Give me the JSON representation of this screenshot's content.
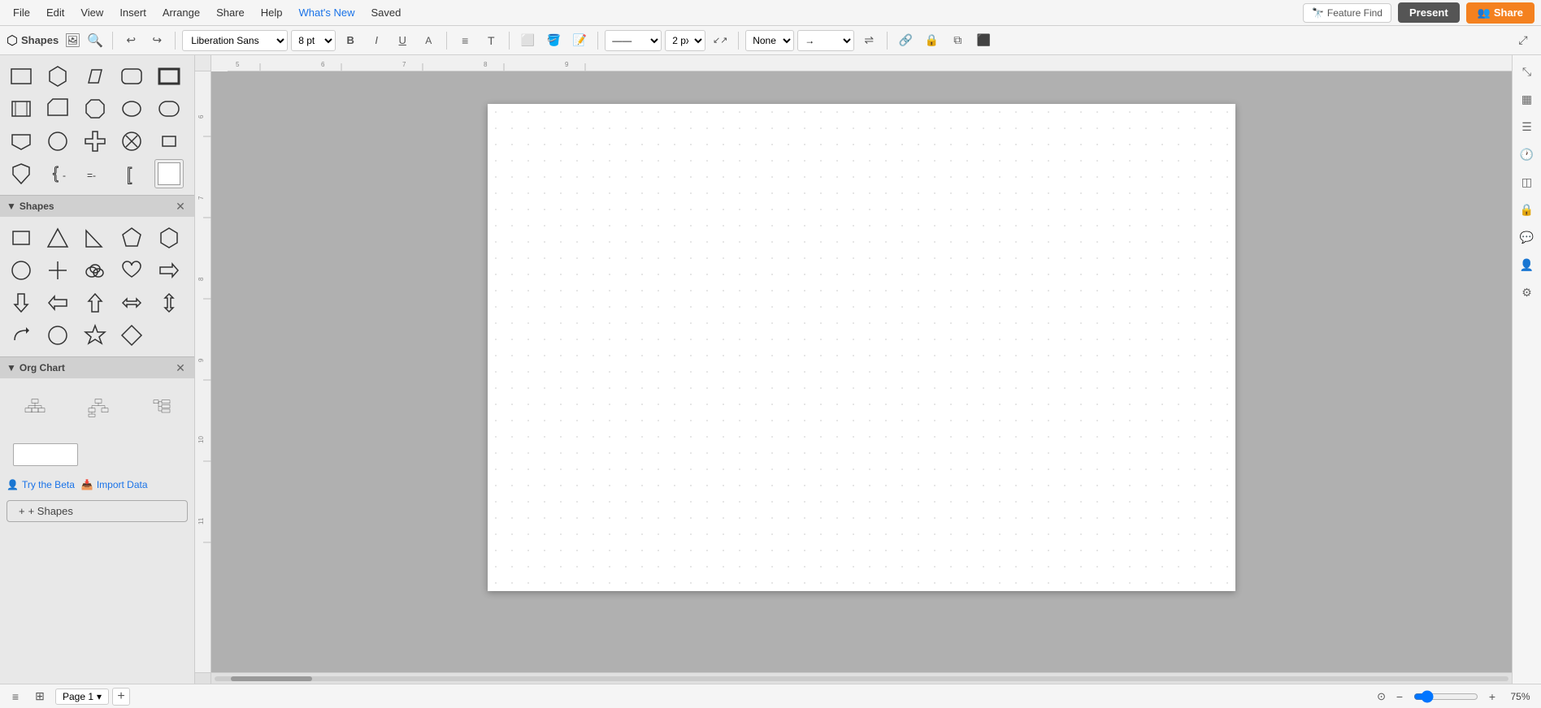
{
  "menu": {
    "items": [
      {
        "label": "File",
        "active": false
      },
      {
        "label": "Edit",
        "active": false
      },
      {
        "label": "View",
        "active": false
      },
      {
        "label": "Insert",
        "active": false
      },
      {
        "label": "Arrange",
        "active": false
      },
      {
        "label": "Share",
        "active": false
      },
      {
        "label": "Help",
        "active": false
      },
      {
        "label": "What's New",
        "active": true
      },
      {
        "label": "Saved",
        "active": false
      }
    ],
    "feature_find": "Feature Find",
    "present": "Present",
    "share": "Share"
  },
  "toolbar": {
    "font": "Liberation Sans",
    "font_size": "8 pt",
    "px": "2 px",
    "line_style": "——",
    "connection_style": "None",
    "arrow_style": "→"
  },
  "left_panel": {
    "title": "Shapes",
    "search_placeholder": "Search",
    "sections": [
      {
        "title": "Shapes",
        "closeable": true
      },
      {
        "title": "Org Chart",
        "closeable": true
      }
    ],
    "try_beta": "Try the Beta",
    "import_data": "Import Data",
    "add_shapes": "+ Shapes"
  },
  "right_panel": {
    "icons": [
      "expand-icon",
      "table-icon",
      "format-icon",
      "clock-icon",
      "layers-icon",
      "lock-icon",
      "comment-icon",
      "user-icon",
      "settings-icon"
    ]
  },
  "bottom": {
    "page_label": "Page 1",
    "zoom_pct": "75%"
  }
}
